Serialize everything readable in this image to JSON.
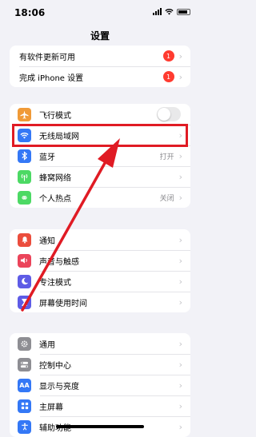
{
  "status_bar": {
    "time": "18:06"
  },
  "nav": {
    "title": "设置"
  },
  "group1": [
    {
      "label": "有软件更新可用",
      "badge": "1"
    },
    {
      "label": "完成 iPhone 设置",
      "badge": "1"
    }
  ],
  "group2": [
    {
      "label": "飞行模式",
      "icon": "airplane-icon",
      "color": "#f09a37",
      "toggle": false
    },
    {
      "label": "无线局域网",
      "icon": "wifi-icon",
      "color": "#3478f6"
    },
    {
      "label": "蓝牙",
      "icon": "bluetooth-icon",
      "color": "#3478f6",
      "value": "打开"
    },
    {
      "label": "蜂窝网络",
      "icon": "cellular-icon",
      "color": "#4cd964"
    },
    {
      "label": "个人热点",
      "icon": "hotspot-icon",
      "color": "#4cd964",
      "value": "关闭"
    }
  ],
  "group3": [
    {
      "label": "通知",
      "icon": "notification-icon",
      "color": "#eb4d3d"
    },
    {
      "label": "声音与触感",
      "icon": "sound-icon",
      "color": "#eb445a"
    },
    {
      "label": "专注模式",
      "icon": "moon-icon",
      "color": "#5e5ce6"
    },
    {
      "label": "屏幕使用时间",
      "icon": "hourglass-icon",
      "color": "#5e5ce6"
    }
  ],
  "group4": [
    {
      "label": "通用",
      "icon": "gear-icon",
      "color": "#8e8e93"
    },
    {
      "label": "控制中心",
      "icon": "switches-icon",
      "color": "#8e8e93"
    },
    {
      "label": "显示与亮度",
      "icon": "display-icon",
      "color": "#3478f6",
      "glyph": "AA"
    },
    {
      "label": "主屏幕",
      "icon": "home-screen-icon",
      "color": "#3478f6"
    },
    {
      "label": "辅助功能",
      "icon": "accessibility-icon",
      "color": "#3478f6"
    }
  ],
  "annotation_color": "#e01b24"
}
